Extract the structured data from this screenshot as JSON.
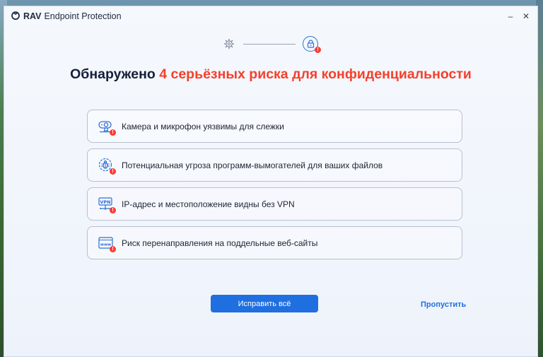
{
  "titlebar": {
    "brand": "RAV",
    "product": "Endpoint Protection",
    "minimize_glyph": "–",
    "close_glyph": "✕",
    "logo_icon": "rav-logo-icon"
  },
  "steps": {
    "step1_icon": "gear-icon",
    "step2_icon": "lock-icon"
  },
  "headline": {
    "prefix": "Обнаружено",
    "highlight": "4 серьёзных риска для конфиденциальности",
    "highlight_color": "#f5402c"
  },
  "risks": [
    {
      "icon": "webcam-icon",
      "label": "Камера и микрофон уязвимы для слежки"
    },
    {
      "icon": "ransomware-bug-icon",
      "label": "Потенциальная угроза программ-вымогателей для ваших файлов"
    },
    {
      "icon": "vpn-icon",
      "label": "IP-адрес и местоположение видны без VPN"
    },
    {
      "icon": "browser-www-icon",
      "label": "Риск перенаправления на поддельные веб-сайты"
    }
  ],
  "alert_badge": "!",
  "actions": {
    "fix_label": "Исправить всё",
    "skip_label": "Пропустить",
    "accent_color": "#1f6fe0"
  }
}
